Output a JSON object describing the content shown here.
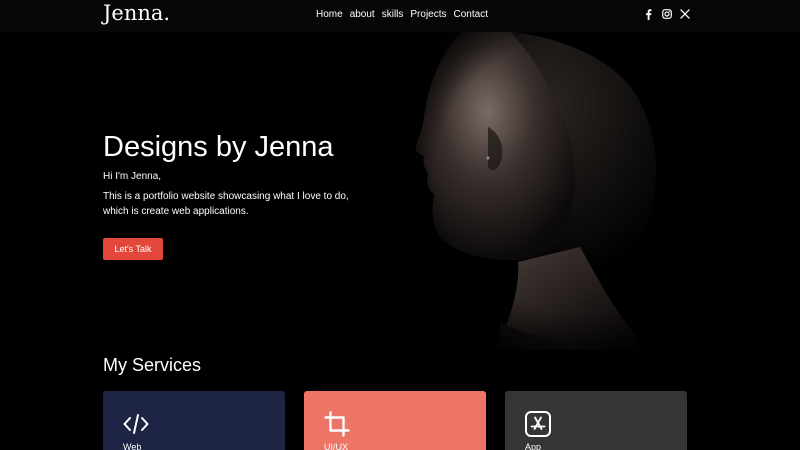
{
  "header": {
    "logo": "Jenna.",
    "nav": [
      "Home",
      "about",
      "skills",
      "Projects",
      "Contact"
    ],
    "social_icons": [
      "facebook-icon",
      "instagram-icon",
      "x-icon"
    ]
  },
  "hero": {
    "title": "Designs by Jenna",
    "greeting": "Hi I'm Jenna,",
    "description": "This is a portfolio website showcasing what I love to do, which is create web applications.",
    "cta_label": "Let's Talk",
    "image": "portrait-photo"
  },
  "services": {
    "title": "My Services",
    "cards": [
      {
        "label": "Web",
        "icon": "code-icon",
        "color": "#1e2443"
      },
      {
        "label": "UI/UX",
        "icon": "crop-icon",
        "color": "#ec7565"
      },
      {
        "label": "App",
        "icon": "app-store-icon",
        "color": "#353535"
      }
    ]
  },
  "colors": {
    "accent": "#e2473a",
    "background": "#000000"
  }
}
